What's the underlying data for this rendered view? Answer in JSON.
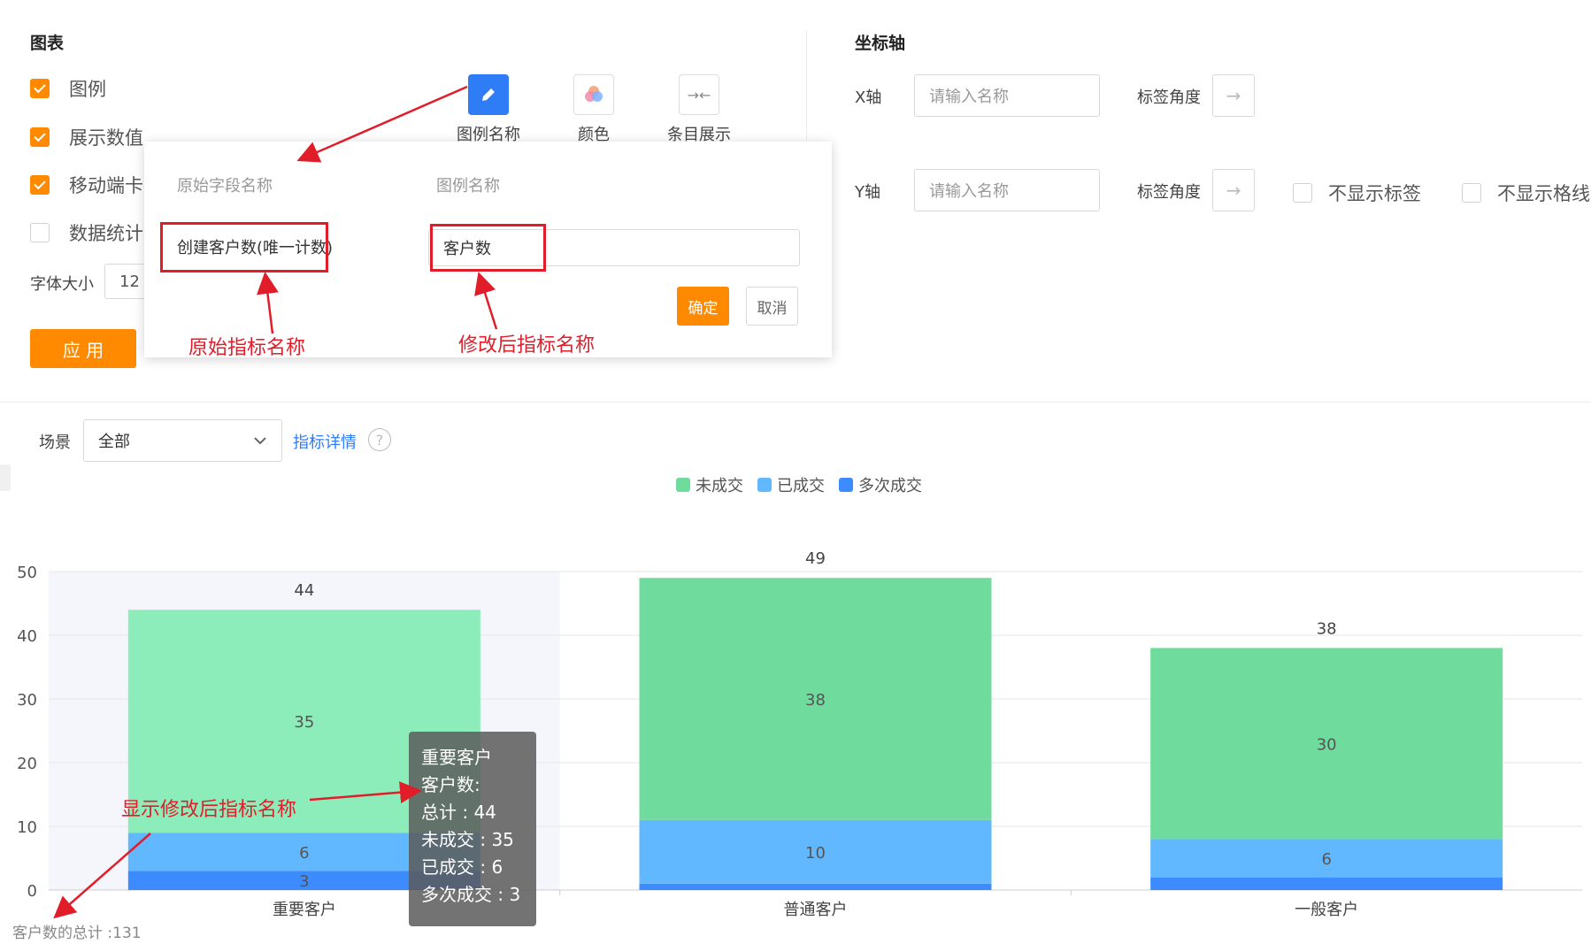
{
  "chart_panel": {
    "title": "图表",
    "options": [
      {
        "label": "图例",
        "checked": true
      },
      {
        "label": "展示数值",
        "checked": true
      },
      {
        "label": "移动端卡",
        "checked": true
      },
      {
        "label": "数据统计",
        "checked": false
      }
    ],
    "font_size_label": "字体大小",
    "font_size_value": "12",
    "apply_label": "应 用",
    "tools": [
      {
        "label": "图例名称",
        "icon": "pencil-icon"
      },
      {
        "label": "颜色",
        "icon": "color-palette-icon"
      },
      {
        "label": "条目展示",
        "icon": "collapse-arrows-icon"
      }
    ]
  },
  "axis_panel": {
    "title": "坐标轴",
    "x_label": "X轴",
    "x_placeholder": "请输入名称",
    "y_label": "Y轴",
    "y_placeholder": "请输入名称",
    "angle_label": "标签角度",
    "hide_labels": "不显示标签",
    "hide_grid": "不显示格线"
  },
  "popup": {
    "col_original": "原始字段名称",
    "col_legend": "图例名称",
    "original_value": "创建客户数(唯一计数)",
    "legend_value": "客户数",
    "confirm": "确定",
    "cancel": "取消"
  },
  "annotations": {
    "original_name": "原始指标名称",
    "modified_name": "修改后指标名称",
    "show_modified": "显示修改后指标名称"
  },
  "filter": {
    "scene_label": "场景",
    "scene_value": "全部",
    "detail_link": "指标详情",
    "help": "?"
  },
  "chart_data": {
    "type": "bar",
    "stacked": true,
    "categories": [
      "重要客户",
      "普通客户",
      "一般客户"
    ],
    "series": [
      {
        "name": "多次成交",
        "values": [
          3,
          1,
          2
        ],
        "color": "#3c8cff"
      },
      {
        "name": "已成交",
        "values": [
          6,
          10,
          6
        ],
        "color": "#62b8ff"
      },
      {
        "name": "未成交",
        "values": [
          35,
          38,
          30
        ],
        "color": "#6fdb9c"
      }
    ],
    "segment_labels": [
      [
        "3",
        "6",
        "35"
      ],
      [
        "",
        "10",
        "38"
      ],
      [
        "",
        "6",
        "30"
      ]
    ],
    "totals": [
      44,
      49,
      38
    ],
    "ylim": [
      0,
      50
    ],
    "yticks": [
      0,
      10,
      20,
      30,
      40,
      50
    ],
    "highlight_color": "#8cedbb",
    "legend_position": "top-center",
    "grid": true
  },
  "tooltip": {
    "title": "重要客户",
    "metric": "客户数:",
    "lines": [
      "总计 : 44",
      "未成交 : 35",
      "已成交 : 6",
      "多次成交 : 3"
    ]
  },
  "footer": {
    "total_text": "客户数的总计 :131"
  }
}
